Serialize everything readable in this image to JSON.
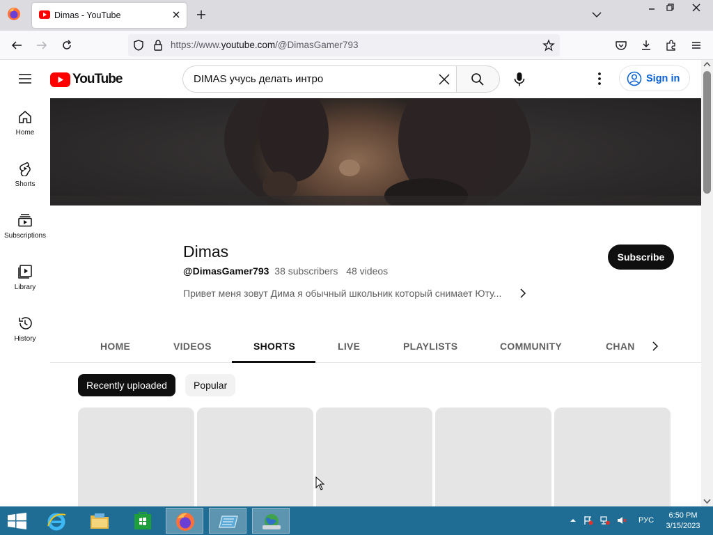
{
  "browser": {
    "tab_title": "Dimas - YouTube",
    "url_prefix": "https://www.",
    "url_host": "youtube.com",
    "url_path": "/@DimasGamer793"
  },
  "youtube": {
    "logo_text": "YouTube",
    "search_value": "DIMAS учусь делать интро",
    "signin_label": "Sign in",
    "sidebar": [
      {
        "label": "Home",
        "icon": "home-icon"
      },
      {
        "label": "Shorts",
        "icon": "shorts-icon"
      },
      {
        "label": "Subscriptions",
        "icon": "subscriptions-icon"
      },
      {
        "label": "Library",
        "icon": "library-icon"
      },
      {
        "label": "History",
        "icon": "history-icon"
      }
    ],
    "channel": {
      "name": "Dimas",
      "handle": "@DimasGamer793",
      "subscribers": "38 subscribers",
      "videos": "48 videos",
      "description": "Привет меня зовут Дима я обычный школьник который снимает Юту...",
      "subscribe_label": "Subscribe"
    },
    "tabs": [
      "HOME",
      "VIDEOS",
      "SHORTS",
      "LIVE",
      "PLAYLISTS",
      "COMMUNITY",
      "CHANNELS"
    ],
    "active_tab": "SHORTS",
    "chips": [
      "Recently uploaded",
      "Popular"
    ]
  },
  "taskbar": {
    "language": "РУС",
    "time": "6:50 PM",
    "date": "3/15/2023"
  },
  "colors": {
    "yt_red": "#ff0000",
    "link_blue": "#065fd4",
    "taskbar": "#1f6d94"
  }
}
